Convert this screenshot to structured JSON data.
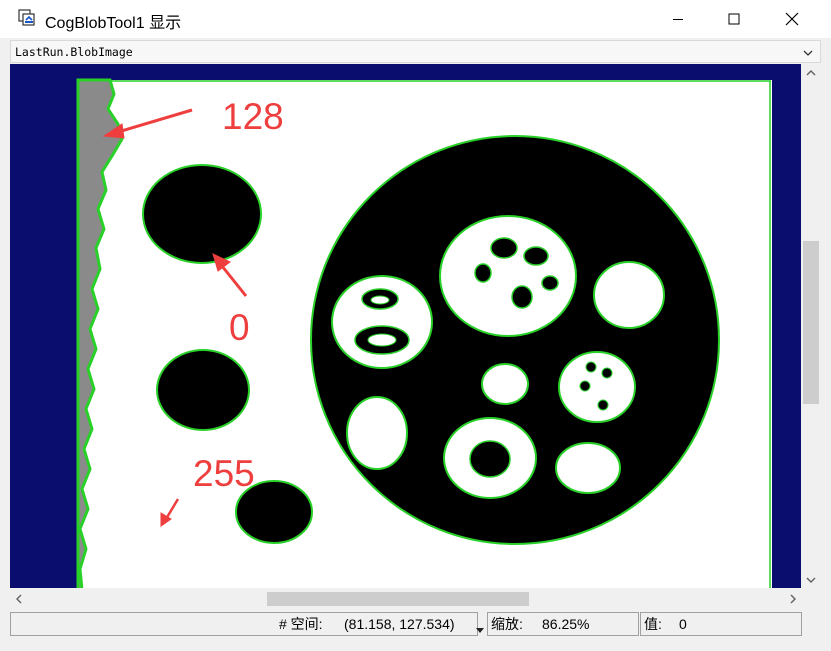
{
  "window": {
    "title": "CogBlobTool1 显示",
    "app_icon": "cognex-display-icon",
    "buttons": [
      "minimize-icon",
      "maximize-icon",
      "close-icon"
    ]
  },
  "view_selector": {
    "selected": "LastRun.BlobImage"
  },
  "image": {
    "annotations": [
      "128",
      "0",
      "255"
    ],
    "annotation_color": "#ee3e3e",
    "blob_outline_color": "#22cc22",
    "background_color": "#0b0d6e"
  },
  "status": {
    "space_label": "# 空间:",
    "coordinates": "(81.158, 127.534)",
    "zoom_label": "缩放:",
    "zoom_value": "86.25%",
    "value_label": "值:",
    "value": "0"
  }
}
